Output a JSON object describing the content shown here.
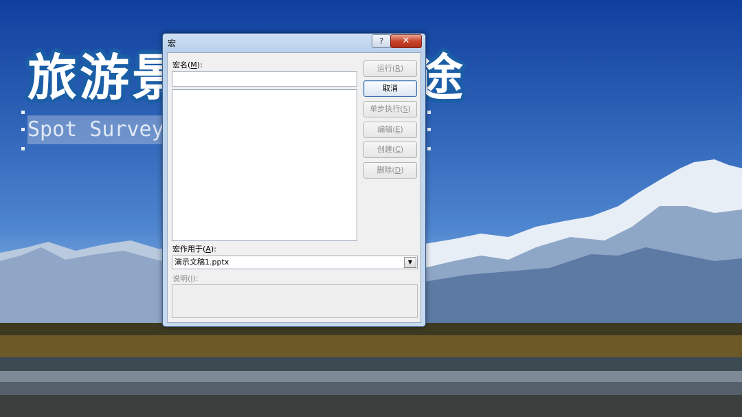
{
  "slide": {
    "title": "旅游景",
    "title_tail": "途",
    "subtitle": "Spot Survey"
  },
  "dialog": {
    "title": "宏",
    "help_label": "?",
    "close_label": "✕",
    "macro_name_label": "宏名(",
    "macro_name_key": "M",
    "macro_name_end": "):",
    "macro_name_value": "",
    "macro_list": [],
    "macro_in_label": "宏作用于(",
    "macro_in_key": "A",
    "macro_in_end": "):",
    "macro_in_value": "演示文稿1.pptx",
    "description_label": "说明(",
    "description_key": "I",
    "description_end": "):",
    "description_value": "",
    "buttons": {
      "run": {
        "label": "运行(",
        "key": "R",
        "end": ")"
      },
      "cancel": {
        "label": "取消"
      },
      "step": {
        "label": "单步执行(",
        "key": "S",
        "end": ")"
      },
      "edit": {
        "label": "编辑(",
        "key": "E",
        "end": ")"
      },
      "create": {
        "label": "创建(",
        "key": "C",
        "end": ")"
      },
      "delete": {
        "label": "删除(",
        "key": "D",
        "end": ")"
      }
    }
  },
  "colors": {
    "sky_top": "#0f3f9e",
    "title_outline": "#1b5ea6",
    "dialog_frame": "#b9d1ec",
    "close_red": "#c8442a"
  },
  "icons": {
    "help": "question-mark",
    "close": "x-mark",
    "dropdown": "triangle-down"
  }
}
